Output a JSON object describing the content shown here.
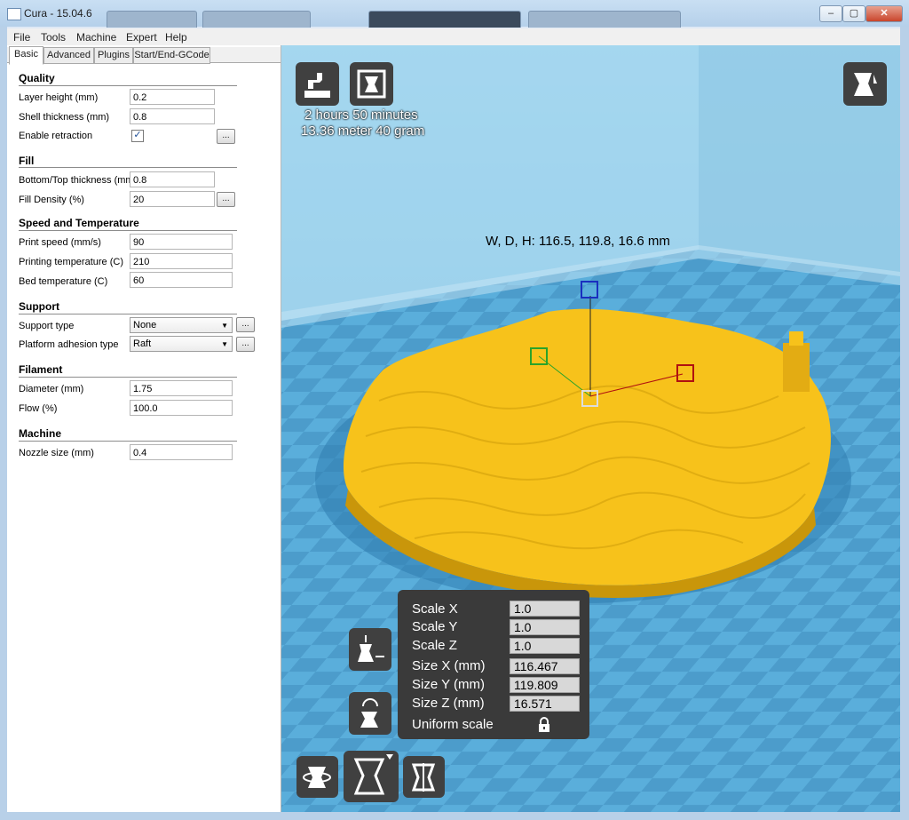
{
  "window": {
    "title": "Cura - 15.04.6",
    "min_label": "–",
    "max_label": "▢",
    "close_label": "✕"
  },
  "menu": [
    "File",
    "Tools",
    "Machine",
    "Expert",
    "Help"
  ],
  "tabs": [
    "Basic",
    "Advanced",
    "Plugins",
    "Start/End-GCode"
  ],
  "settings": {
    "quality": {
      "title": "Quality",
      "layer_height": {
        "label": "Layer height (mm)",
        "value": "0.2"
      },
      "shell_thickness": {
        "label": "Shell thickness (mm)",
        "value": "0.8"
      },
      "enable_retraction": {
        "label": "Enable retraction",
        "checked": "✓"
      }
    },
    "fill": {
      "title": "Fill",
      "bottom_top_thickness": {
        "label": "Bottom/Top thickness (mm)",
        "value": "0.8"
      },
      "fill_density": {
        "label": "Fill Density (%)",
        "value": "20"
      }
    },
    "speed": {
      "title": "Speed and Temperature",
      "print_speed": {
        "label": "Print speed (mm/s)",
        "value": "90"
      },
      "printing_temperature": {
        "label": "Printing temperature (C)",
        "value": "210"
      },
      "bed_temperature": {
        "label": "Bed temperature (C)",
        "value": "60"
      }
    },
    "support": {
      "title": "Support",
      "support_type": {
        "label": "Support type",
        "value": "None"
      },
      "platform_adhesion": {
        "label": "Platform adhesion type",
        "value": "Raft"
      }
    },
    "filament": {
      "title": "Filament",
      "diameter": {
        "label": "Diameter (mm)",
        "value": "1.75"
      },
      "flow": {
        "label": "Flow (%)",
        "value": "100.0"
      }
    },
    "machine": {
      "title": "Machine",
      "nozzle_size": {
        "label": "Nozzle size (mm)",
        "value": "0.4"
      }
    },
    "dots_label": "..."
  },
  "viewport": {
    "print_time": "2 hours 50 minutes",
    "print_material": "13.36 meter 40 gram",
    "dimensions": "W, D, H: 116.5, 119.8, 16.6 mm"
  },
  "scale_panel": {
    "scale_x": {
      "label": "Scale X",
      "value": "1.0"
    },
    "scale_y": {
      "label": "Scale Y",
      "value": "1.0"
    },
    "scale_z": {
      "label": "Scale Z",
      "value": "1.0"
    },
    "size_x": {
      "label": "Size X (mm)",
      "value": "116.467"
    },
    "size_y": {
      "label": "Size Y (mm)",
      "value": "119.809"
    },
    "size_z": {
      "label": "Size Z (mm)",
      "value": "16.571"
    },
    "uniform": {
      "label": "Uniform scale"
    }
  },
  "colors": {
    "model": "#f7c21b",
    "bed": "#5aa9d6",
    "panel": "#3a3a3a"
  },
  "icons": [
    "load-model-icon",
    "print-icon",
    "view-mode-icon",
    "scale-max-icon",
    "reset-scale-icon",
    "rotate-tool-icon",
    "scale-tool-icon",
    "mirror-tool-icon",
    "lock-icon"
  ]
}
